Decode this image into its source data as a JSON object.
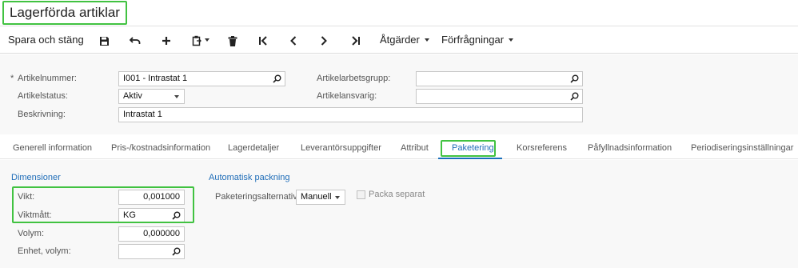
{
  "header": {
    "title": "Lagerförda artiklar"
  },
  "toolbar": {
    "save_close": "Spara och stäng",
    "actions": "Åtgärder",
    "inquiries": "Förfrågningar"
  },
  "form": {
    "item_number_label": "Artikelnummer:",
    "item_number_required": "*",
    "item_number_value": "I001 - Intrastat 1",
    "item_status_label": "Artikelstatus:",
    "item_status_value": "Aktiv",
    "description_label": "Beskrivning:",
    "description_value": "Intrastat 1",
    "item_workgroup_label": "Artikelarbetsgrupp:",
    "item_workgroup_value": "",
    "item_owner_label": "Artikelansvarig:",
    "item_owner_value": ""
  },
  "tabs": [
    {
      "label": "Generell information"
    },
    {
      "label": "Pris-/kostnadsinformation"
    },
    {
      "label": "Lagerdetaljer"
    },
    {
      "label": "Leverantörsuppgifter"
    },
    {
      "label": "Attribut"
    },
    {
      "label": "Paketering",
      "active": true
    },
    {
      "label": "Korsreferens"
    },
    {
      "label": "Påfyllnadsinformation"
    },
    {
      "label": "Periodiseringsinställningar"
    }
  ],
  "dimensions": {
    "section_title": "Dimensioner",
    "weight_label": "Vikt:",
    "weight_value": "0,001000",
    "weight_uom_label": "Viktmått:",
    "weight_uom_value": "KG",
    "volume_label": "Volym:",
    "volume_value": "0,000000",
    "volume_unit_label": "Enhet, volym:",
    "volume_unit_value": ""
  },
  "packing": {
    "section_title": "Automatisk packning",
    "option_label": "Paketeringsalternativ:",
    "option_value": "Manuell",
    "pack_separate_label": "Packa separat",
    "pack_separate_checked": false
  },
  "colors": {
    "highlight": "#41c241",
    "accent": "#1f6db8"
  }
}
